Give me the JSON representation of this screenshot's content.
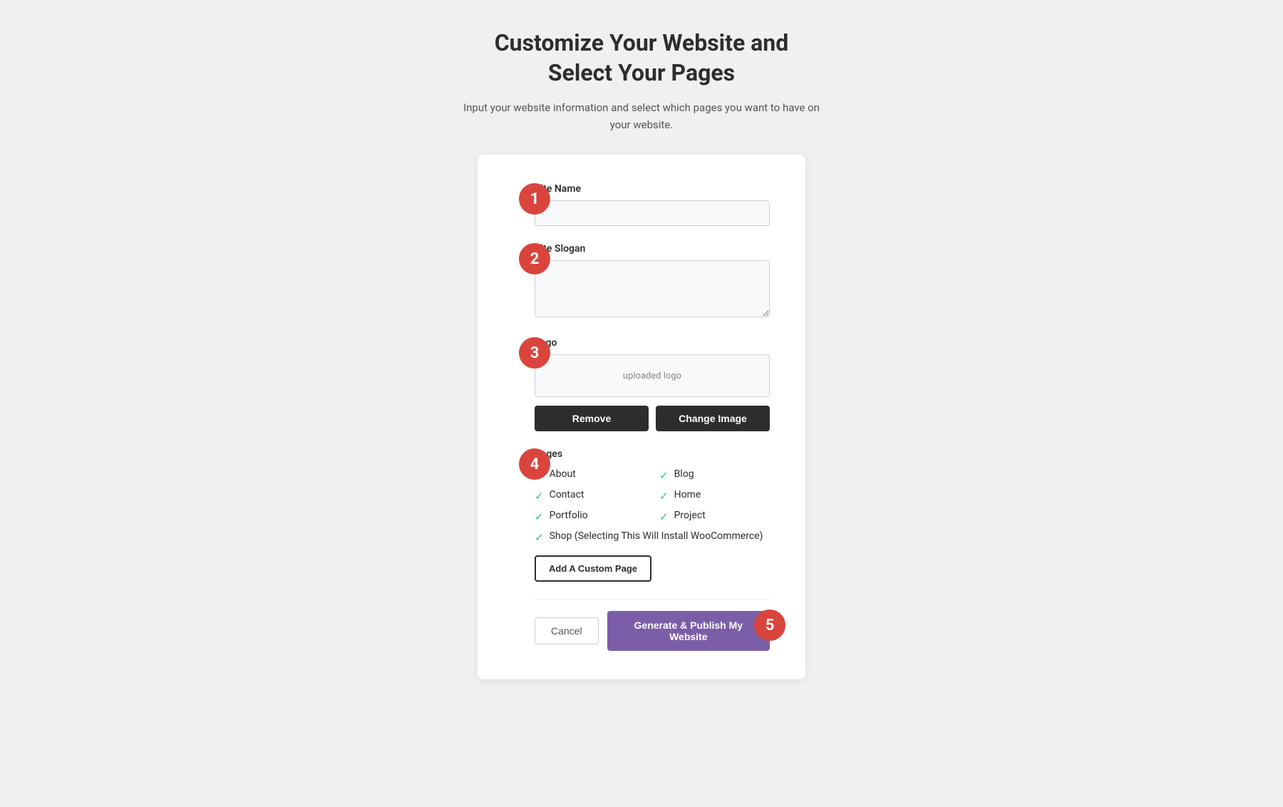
{
  "header": {
    "title_line1": "Customize Your Website and",
    "title_line2": "Select Your Pages",
    "subtitle": "Input your website information and select which pages you want to have on your website."
  },
  "form": {
    "site_name_label": "Site Name",
    "site_name_placeholder": "",
    "site_slogan_label": "Site Slogan",
    "site_slogan_placeholder": "",
    "logo_label": "Logo",
    "logo_placeholder": "uploaded logo",
    "remove_button": "Remove",
    "change_image_button": "Change Image",
    "pages_label": "Pages",
    "pages": [
      {
        "id": "about",
        "label": "About",
        "checked": true,
        "col": 1
      },
      {
        "id": "blog",
        "label": "Blog",
        "checked": true,
        "col": 2
      },
      {
        "id": "contact",
        "label": "Contact",
        "checked": true,
        "col": 1
      },
      {
        "id": "home",
        "label": "Home",
        "checked": true,
        "col": 2
      },
      {
        "id": "portfolio",
        "label": "Portfolio",
        "checked": true,
        "col": 1
      },
      {
        "id": "project",
        "label": "Project",
        "checked": true,
        "col": 2
      },
      {
        "id": "shop",
        "label": "Shop (Selecting This Will Install WooCommerce)",
        "checked": true,
        "col": 1,
        "wide": true
      }
    ],
    "add_custom_page_button": "Add A Custom Page",
    "cancel_button": "Cancel",
    "generate_button": "Generate & Publish My Website"
  },
  "steps": {
    "step1": "1",
    "step2": "2",
    "step3": "3",
    "step4": "4",
    "step5": "5"
  },
  "colors": {
    "accent_red": "#d9453d",
    "accent_purple": "#7b5ea7",
    "checkmark": "#2bbbad"
  }
}
